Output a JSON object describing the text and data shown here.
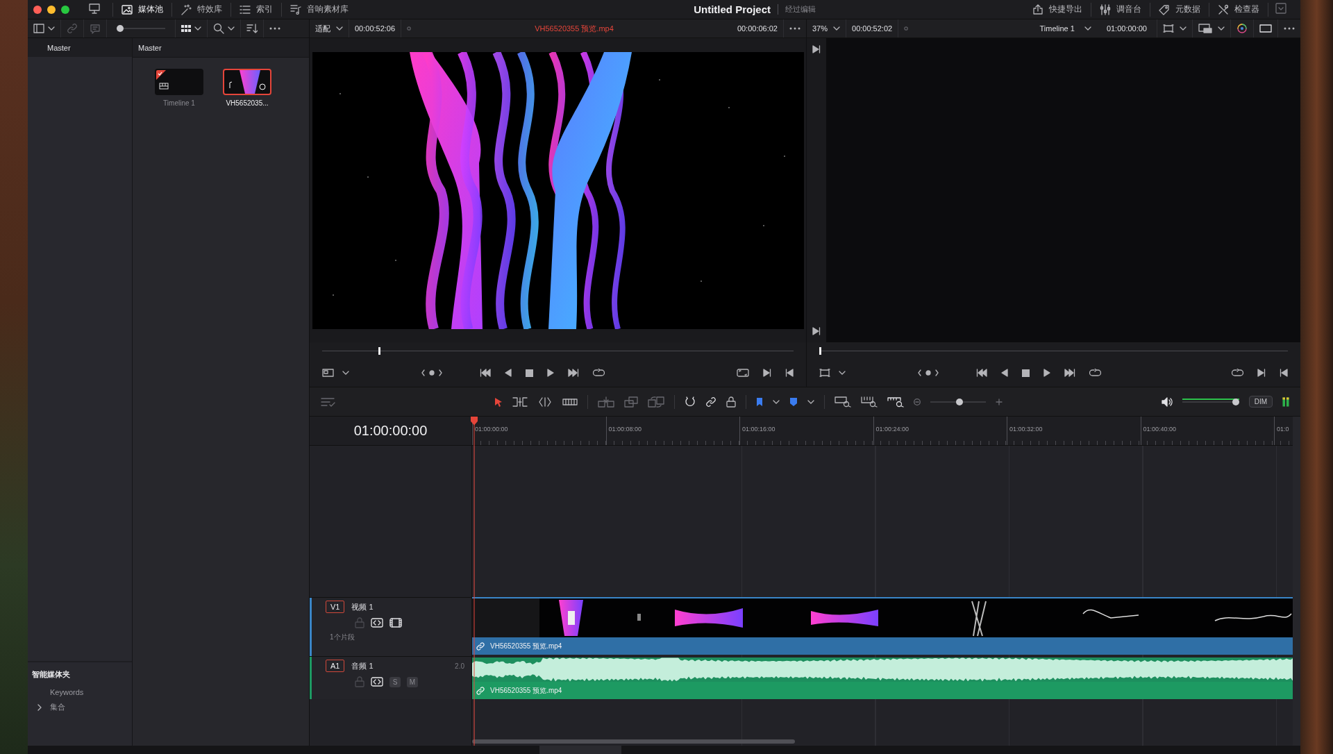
{
  "window": {
    "title": "Untitled Project",
    "subtitle": "经过编辑"
  },
  "top_tabs": [
    {
      "label": "媒体池",
      "selected": true
    },
    {
      "label": "特效库",
      "selected": false
    },
    {
      "label": "索引",
      "selected": false
    },
    {
      "label": "音响素材库",
      "selected": false
    }
  ],
  "right_tabs": [
    {
      "label": "快捷导出"
    },
    {
      "label": "调音台"
    },
    {
      "label": "元数据"
    },
    {
      "label": "检查器"
    }
  ],
  "bin_toolbar": {
    "thumb_size": {
      "level": 0
    }
  },
  "sidebar": {
    "header": "Master",
    "smart_bins_title": "智能媒体夹",
    "smart_bins": [
      {
        "label": "Keywords",
        "expandable": false
      },
      {
        "label": "集合",
        "expandable": true
      }
    ]
  },
  "bin": {
    "header": "Master",
    "clips": [
      {
        "kind": "timeline",
        "name": "Timeline 1",
        "selected": false
      },
      {
        "kind": "video",
        "name": "VH5652035...",
        "selected": true
      }
    ]
  },
  "source_viewer": {
    "zoom": "适配",
    "duration": "00:00:52:06",
    "clip_name": "VH56520355 预览.mp4",
    "timecode": "00:00:06:02",
    "scrubber": {
      "level": 0.12
    }
  },
  "timeline_viewer": {
    "zoom": "37%",
    "duration": "00:00:52:02",
    "timeline_name": "Timeline 1",
    "timecode": "01:00:00:00",
    "scrubber": {
      "level": 0
    }
  },
  "timeline": {
    "timecode": "01:00:00:00",
    "zoom_slider": {
      "level": 0.53
    },
    "volume": {
      "level": 1
    },
    "dim": "DIM",
    "ruler": [
      "01:00:00:00",
      "01:00:08:00",
      "01:00:16:00",
      "01:00:24:00",
      "01:00:32:00",
      "01:00:40:00",
      "01:0"
    ],
    "tracks": [
      {
        "kind": "video",
        "id": "V1",
        "name": "视频 1",
        "info": "1个片段",
        "clip": "VH56520355 预览.mp4"
      },
      {
        "kind": "audio",
        "id": "A1",
        "name": "音频 1",
        "channels": "2.0",
        "solo": "S",
        "mute": "M",
        "clip": "VH56520355 预览.mp4"
      }
    ]
  }
}
